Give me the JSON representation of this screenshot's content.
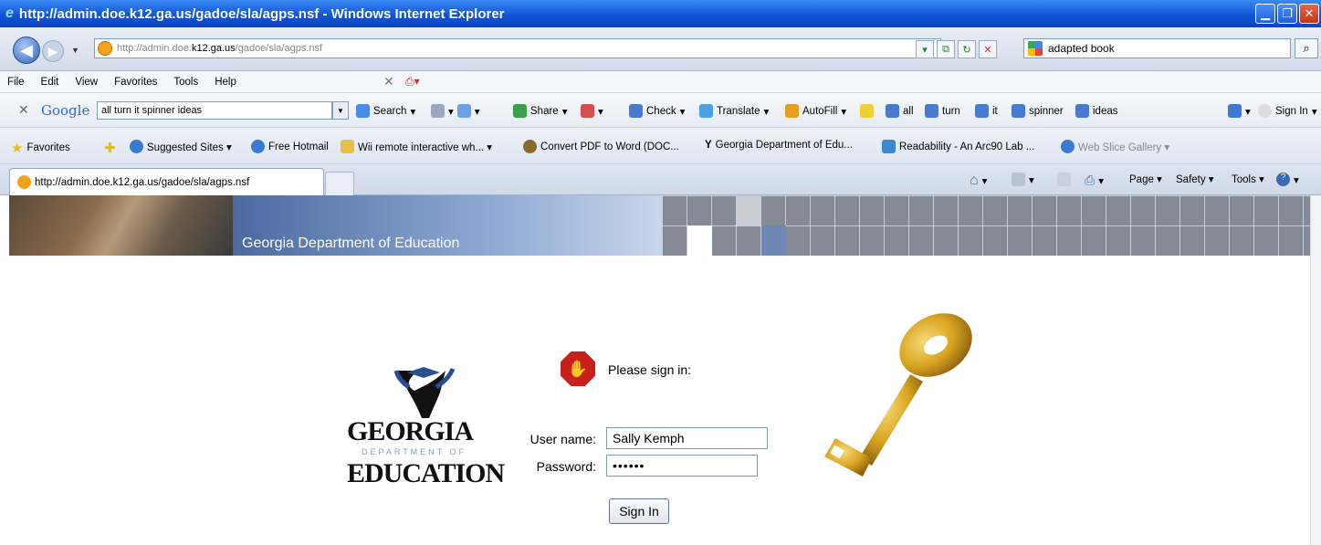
{
  "window": {
    "title": "http://admin.doe.k12.ga.us/gadoe/sla/agps.nsf - Windows Internet Explorer"
  },
  "address": {
    "prefix": "http://admin.doe.",
    "domain": "k12.ga.us",
    "path": "/gadoe/sla/agps.nsf"
  },
  "search": {
    "value": "adapted book"
  },
  "menu": [
    "File",
    "Edit",
    "View",
    "Favorites",
    "Tools",
    "Help"
  ],
  "google_toolbar": {
    "logo": "Google",
    "query": "all turn it spinner ideas",
    "items": [
      "Search",
      "Share",
      "Check",
      "Translate",
      "AutoFill",
      "all",
      "turn",
      "it",
      "spinner",
      "ideas"
    ],
    "signin": "Sign In"
  },
  "favorites": {
    "label": "Favorites",
    "items": [
      "Suggested Sites ▾",
      "Free Hotmail",
      "Wii remote interactive wh... ▾",
      "Convert PDF to Word (DOC...",
      "Georgia Department of Edu...",
      "Readability - An Arc90 Lab ...",
      "Web Slice Gallery ▾"
    ]
  },
  "tab": {
    "title": "http://admin.doe.k12.ga.us/gadoe/sla/agps.nsf"
  },
  "commandbar": [
    "Page ▾",
    "Safety ▾",
    "Tools ▾"
  ],
  "banner": {
    "title": "Georgia Department of Education"
  },
  "logo": {
    "line1": "GEORGIA",
    "line2": "DEPARTMENT OF",
    "line3": "EDUCATION"
  },
  "login": {
    "message": "Please sign in:",
    "username_label": "User name:",
    "username_value": "Sally Kemph",
    "password_label": "Password:",
    "password_value": "••••••",
    "button": "Sign In"
  },
  "colors": {
    "titlebar": "#0f55d6",
    "stop": "#c8201c",
    "key": "#d9a520"
  }
}
